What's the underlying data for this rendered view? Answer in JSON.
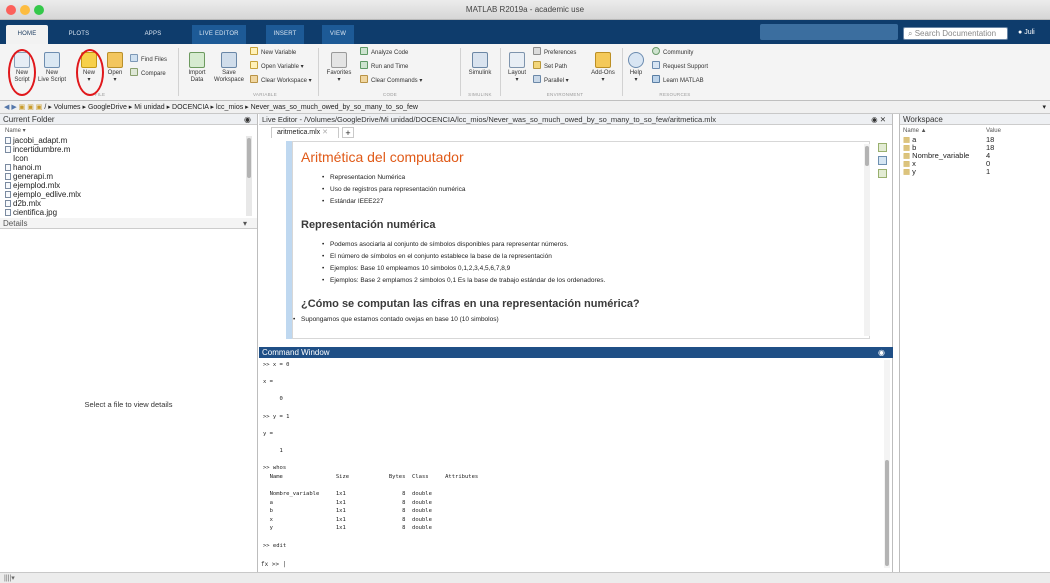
{
  "window": {
    "title": "MATLAB R2019a - academic use"
  },
  "tabs": [
    "HOME",
    "PLOTS",
    "APPS",
    "LIVE EDITOR",
    "INSERT",
    "VIEW"
  ],
  "search": {
    "placeholder": "Search Documentation",
    "user": "Juli"
  },
  "ribbon": {
    "file": {
      "new_script": "New\nScript",
      "new_live_script": "New\nLive Script",
      "new": "New",
      "open": "Open",
      "find_files": "Find Files",
      "compare": "Compare"
    },
    "variable": {
      "import_data": "Import\nData",
      "save_workspace": "Save\nWorkspace",
      "new_variable": "New Variable",
      "open_variable": "Open Variable ▾",
      "clear_workspace": "Clear Workspace ▾",
      "section": "VARIABLE"
    },
    "code": {
      "favorites": "Favorites",
      "analyze_code": "Analyze Code",
      "run_and_time": "Run and Time",
      "clear_commands": "Clear Commands ▾",
      "section": "CODE"
    },
    "simulink": {
      "simulink": "Simulink",
      "section": "SIMULINK"
    },
    "environment": {
      "layout": "Layout",
      "preferences": "Preferences",
      "set_path": "Set Path",
      "parallel": "Parallel ▾",
      "add_ons": "Add-Ons",
      "section": "ENVIRONMENT"
    },
    "resources": {
      "help": "Help",
      "community": "Community",
      "request_support": "Request Support",
      "learn_matlab": "Learn MATLAB",
      "section": "RESOURCES"
    },
    "file_section": "FILE"
  },
  "path": "/ ▸ Volumes ▸ GoogleDrive ▸ Mi unidad ▸ DOCENCIA ▸ lcc_mios ▸ Never_was_so_much_owed_by_so_many_to_so_few",
  "current_folder": {
    "title": "Current Folder",
    "column": "Name ▾",
    "files": [
      "jacobi_adapt.m",
      "incertidumbre.m",
      "Icon",
      "hanoi.m",
      "generapi.m",
      "ejemplod.mlx",
      "ejemplo_edlive.mlx",
      "d2b.mlx",
      "cientifica.jpg"
    ],
    "details_title": "Details",
    "details_msg": "Select a file to view details"
  },
  "editor": {
    "title": "Live Editor - /Volumes/GoogleDrive/Mi unidad/DOCENCIA/lcc_mios/Never_was_so_much_owed_by_so_many_to_so_few/aritmetica.mlx",
    "tab": "aritmetica.mlx",
    "heading1": "Aritmética del computador",
    "bullets1": [
      "Representacion Numérica",
      "Uso de registros para representación numérica",
      "Estándar IEEE227"
    ],
    "heading2": "Representación numérica",
    "bullets2": [
      "Podemos asociarla al conjunto de símbolos disponibles para representar números.",
      "El número de símbolos en el conjunto establece la base de la representación",
      "Ejemplos: Base 10 empleamos 10  simbolos 0,1,2,3,4,5,6,7,8,9",
      "Ejemplos: Base 2 emplamos 2 simbolos 0,1 Es la base de trabajo estándar de los ordenadores."
    ],
    "heading3": "¿Cómo se computan las cifras en una representación numérica?",
    "para": "Supongamos que estamos contado ovejas en base 10 (10 simbolos)"
  },
  "command_window": {
    "title": "Command Window",
    "lines": [
      ">> x = 0",
      "",
      "x =",
      "",
      "     0",
      "",
      ">> y = 1",
      "",
      "y =",
      "",
      "     1",
      "",
      ">> whos",
      "  Name                Size            Bytes  Class     Attributes",
      "",
      "  Nombre_variable     1x1                 8  double",
      "  a                   1x1                 8  double",
      "  b                   1x1                 8  double",
      "  x                   1x1                 8  double",
      "  y                   1x1                 8  double",
      "",
      ">> edit"
    ],
    "prompt": "fx >> |"
  },
  "workspace": {
    "title": "Workspace",
    "col_name": "Name ▲",
    "col_value": "Value",
    "vars": [
      {
        "name": "a",
        "value": "18"
      },
      {
        "name": "b",
        "value": "18"
      },
      {
        "name": "Nombre_variable",
        "value": "4"
      },
      {
        "name": "x",
        "value": "0"
      },
      {
        "name": "y",
        "value": "1"
      }
    ]
  },
  "colors": {
    "accent": "#0e3c6c",
    "heading": "#e05a18",
    "highlight": "#e0181c"
  }
}
